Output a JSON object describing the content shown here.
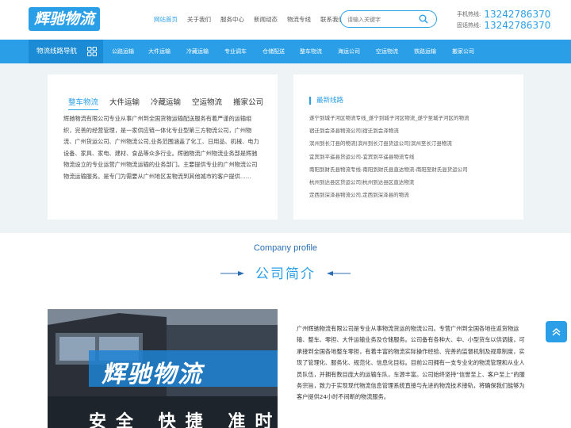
{
  "header": {
    "logo_text": "辉驰物流",
    "nav": [
      "网站首页",
      "关于我们",
      "服务中心",
      "新闻动态",
      "物流专线",
      "联系我们"
    ],
    "search_placeholder": "请输入关键字",
    "mobile_label": "手机热线:",
    "mobile_number": "13242786370",
    "phone_label": "固话热线:",
    "phone_number": "13242786370"
  },
  "navbar": {
    "guide_label": "物流线路导航",
    "links": [
      "公路运输",
      "大件运输",
      "冷藏运输",
      "专业调车",
      "仓储配送",
      "整车物流",
      "海运公司",
      "空运物流",
      "铁路运输",
      "搬家公司"
    ]
  },
  "intro_card": {
    "tabs": [
      "整车物流",
      "大件运输",
      "冷藏运输",
      "空运物流",
      "搬家公司"
    ],
    "text": "辉驰物流有限公司专业从事广州到全国货物运输配送服务有着严谨的运输组织，完善的经营管理，是一家供应链一体化专业型第三方物流公司，广州物流、广州货运公司、广州物流公司,业务范围涵盖了化工、日用品、机械、电力设备、家具、家电、建材、食品等众多行业。辉驰物流广州物流业务部是辉驰物流设立的专业运营广州物流运输的业务部门。主要提供专业的广州物流公司物流运输服务。是专门为需要从广州地区发物流到其他城市的客户提供......"
  },
  "routes_card": {
    "title": "最新线路",
    "items": [
      "遂宁到城子河区物流专线_遂宁到城子河区物流_遂宁至城子河区的物流",
      "宿迁到会泽县物流公司|宿迁到会泽物流",
      "滨州到长汀县的物流|滨州到长汀县货运公司|滨州至长汀县物流",
      "宜宾到平遥县货运公司-宜宾到平遥县物流专线",
      "南阳到财氏县物流专线-南阳到财氏县直达物流-南阳至财氏县货运公司",
      "杭州到达县区货运公司|杭州到达县区直达物流",
      "定西到深泽县物流公司,定西到深泽县的物流"
    ]
  },
  "profile": {
    "title_en": "Company profile",
    "title_cn": "公司简介",
    "photo_slogan": "辉驰物流",
    "photo_slogan2": "安全 快捷 准时",
    "text": "广州辉驰物流有限公司是专业从事物流货运的物流公司。专营广州到全国各地往返货物运输、整车、零担、大件运输业务及仓储服务。公司备有各种大、中、小型货车以供调拨，可承接到全国各地整车零担，有着丰富的物流实际操作经验、完善的监督机制及规章制度，实现了管理化、服务化、规范化、信息化目标。目前公司拥有一支专业化的物流管理和从业人员队伍，并拥有数目庞大的运输车队，车源丰富。公司始终坚持“信誉至上、客户至上”的服务宗旨，致力于实现现代物流信息管理系统直接与先进的物流技术接轨，将确保我们能够为客户提供24小时不间断的物流服务。"
  },
  "colors": {
    "brand": "#2a9fe8",
    "band_bg": "#eef3f6"
  }
}
